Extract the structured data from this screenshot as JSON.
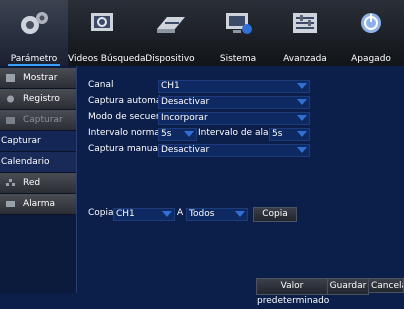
{
  "tabs": [
    {
      "label": "Parámetro",
      "icon": "gears-icon",
      "active": true
    },
    {
      "label": "Videos Búsqueda",
      "icon": "video-search-icon",
      "active": false
    },
    {
      "label": "Dispositivo",
      "icon": "hard-drive-icon",
      "active": false
    },
    {
      "label": "Sistema",
      "icon": "monitor-settings-icon",
      "active": false
    },
    {
      "label": "Avanzada",
      "icon": "sliders-icon",
      "active": false
    },
    {
      "label": "Apagado",
      "icon": "power-icon",
      "active": false
    }
  ],
  "sidebar": {
    "items": [
      {
        "label": "Mostrar",
        "icon": "display-icon"
      },
      {
        "label": "Registro",
        "icon": "record-icon"
      },
      {
        "label": "Capturar",
        "icon": "camera-icon"
      },
      {
        "label": "Capturar",
        "icon": ""
      },
      {
        "label": "Calendario",
        "icon": ""
      },
      {
        "label": "Red",
        "icon": "network-icon"
      },
      {
        "label": "Alarma",
        "icon": "alarm-icon"
      }
    ]
  },
  "form": {
    "canal_label": "Canal",
    "canal_value": "CH1",
    "auto_label": "Captura automática",
    "auto_value": "Desactivar",
    "seq_label": "Modo de secuencia",
    "seq_value": "Incorporar",
    "interval_label": "Intervalo normal",
    "interval_value": "5s",
    "alarm_interval_label": "Intervalo de alarma",
    "alarm_interval_value": "5s",
    "manual_label": "Captura manual",
    "manual_value": "Desactivar"
  },
  "copy": {
    "label": "Copia",
    "from_value": "CH1",
    "to_label": "A",
    "to_value": "Todos",
    "button": "Copia"
  },
  "footer": {
    "default_label": "Valor predeterminado",
    "save_label": "Guardar",
    "cancel_label": "Cancelar"
  },
  "colors": {
    "background": "#0b1f4a",
    "accent": "#3aa0ff",
    "dropdown_arrow": "#2f6fd6"
  }
}
